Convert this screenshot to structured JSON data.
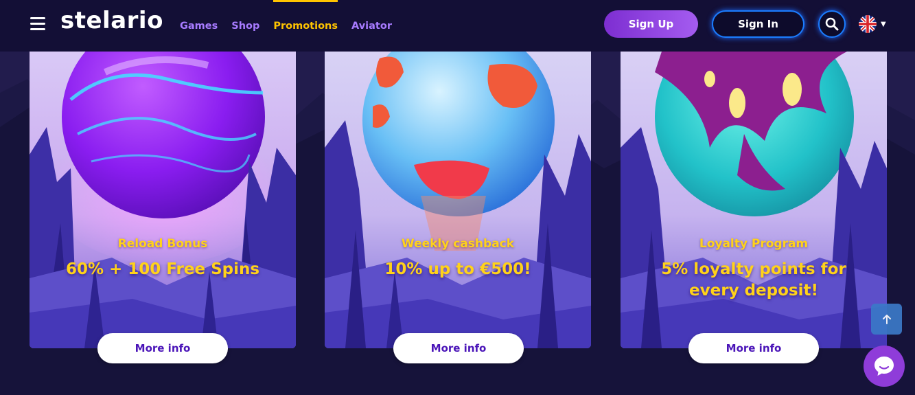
{
  "header": {
    "logo": "stelario",
    "nav": [
      "Games",
      "Shop",
      "Promotions",
      "Aviator"
    ],
    "active_nav": "Promotions",
    "sign_up": "Sign Up",
    "sign_in": "Sign In",
    "language_icon": "uk-flag-icon"
  },
  "cards": [
    {
      "subtitle": "Reload Bonus",
      "headline": "60% + 100 Free Spins",
      "button": "More info"
    },
    {
      "subtitle": "Weekly cashback",
      "headline": "10% up to €500!",
      "button": "More info"
    },
    {
      "subtitle": "Loyalty Program",
      "headline": "5% loyalty points for every deposit!",
      "button": "More info"
    }
  ],
  "colors": {
    "background": "#16133a",
    "header": "#130f36",
    "accent_yellow": "#ffc400",
    "nav_purple": "#a77bff",
    "button_blue": "#1b7dff"
  },
  "icons": [
    "menu-icon",
    "search-icon",
    "arrow-up-icon",
    "chat-icon",
    "caret-down-icon"
  ]
}
